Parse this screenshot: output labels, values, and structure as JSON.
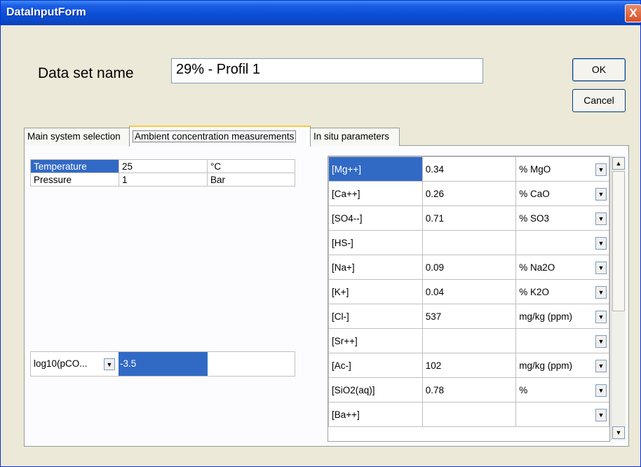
{
  "window": {
    "title": "DataInputForm",
    "close": "X"
  },
  "dataset": {
    "label": "Data set name",
    "value": "29% - Profil 1"
  },
  "buttons": {
    "ok": "OK",
    "cancel": "Cancel"
  },
  "tabs": [
    {
      "label": "Main system selection",
      "active": false
    },
    {
      "label": "Ambient concentration measurements",
      "active": true
    },
    {
      "label": "In situ parameters",
      "active": false
    }
  ],
  "tp_rows": [
    {
      "name": "Temperature",
      "value": "25",
      "unit": "°C"
    },
    {
      "name": "Pressure",
      "value": "1",
      "unit": "Bar"
    }
  ],
  "pco2": {
    "label": "log10(pCO...",
    "value": "-3.5"
  },
  "concentrations": [
    {
      "ion": "[Mg++]",
      "value": "0.34",
      "unit": "% MgO"
    },
    {
      "ion": "[Ca++]",
      "value": "0.26",
      "unit": "% CaO"
    },
    {
      "ion": "[SO4--]",
      "value": "0.71",
      "unit": "% SO3"
    },
    {
      "ion": "[HS-]",
      "value": "",
      "unit": ""
    },
    {
      "ion": "[Na+]",
      "value": "0.09",
      "unit": "% Na2O"
    },
    {
      "ion": "[K+]",
      "value": "0.04",
      "unit": "% K2O"
    },
    {
      "ion": "[Cl-]",
      "value": "537",
      "unit": "mg/kg (ppm)"
    },
    {
      "ion": "[Sr++]",
      "value": "",
      "unit": ""
    },
    {
      "ion": "[Ac-]",
      "value": "102",
      "unit": "mg/kg (ppm)"
    },
    {
      "ion": "[SiO2(aq)]",
      "value": "0.78",
      "unit": "%"
    },
    {
      "ion": "[Ba++]",
      "value": "",
      "unit": ""
    }
  ],
  "icons": {
    "dropdown": "chevron-down-icon",
    "scroll_up": "arrow-up-icon",
    "scroll_down": "arrow-down-icon"
  },
  "colors": {
    "title_bar": "#0a4fd6",
    "selection": "#316ac5",
    "dialog_bg": "#ece9d8"
  }
}
